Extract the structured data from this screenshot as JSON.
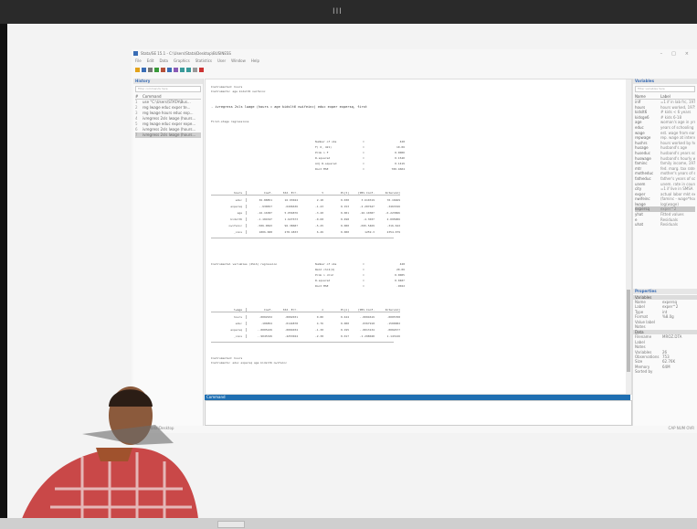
{
  "window": {
    "title": "Stata/SE 15.1 - C:\\Users\\Stata\\Desktop\\BUSINESS",
    "controls": [
      "–",
      "□",
      "×"
    ]
  },
  "menu": [
    "File",
    "Edit",
    "Data",
    "Graphics",
    "Statistics",
    "User",
    "Window",
    "Help"
  ],
  "toolbar_icons": [
    "open-icon",
    "save-icon",
    "print-icon",
    "log-icon",
    "viewer-icon",
    "graph-icon",
    "do-file-icon",
    "data-editor-icon",
    "data-browser-icon",
    "variables-manager-icon",
    "break-icon"
  ],
  "history": {
    "title": "History",
    "filter_placeholder": "Filter commands here",
    "columns": [
      "#",
      "Command"
    ],
    "items": [
      {
        "n": "1",
        "cmd": "use \"C:\\Users\\STATA\\Bus...",
        "selected": false
      },
      {
        "n": "2",
        "cmd": "reg lwage educ exper te...",
        "selected": false
      },
      {
        "n": "3",
        "cmd": "reg lwage hours educ exp...",
        "selected": false
      },
      {
        "n": "4",
        "cmd": "ivregress 2sls lwage (hours...",
        "selected": false
      },
      {
        "n": "5",
        "cmd": "reg lwage educ exper expe...",
        "selected": false
      },
      {
        "n": "6",
        "cmd": "ivregress 2sls lwage (hours...",
        "selected": false
      },
      {
        "n": "7",
        "cmd": "ivregress 2sls lwage (hours...",
        "selected": true
      }
    ]
  },
  "results": {
    "header_lines": [
      "Instrumented:  hours",
      "Instruments:   age kidslt6 nwifeinc"
    ],
    "command_line": ". ivregress 2sls lwage (hours = age kidslt6 nwifeinc) educ exper expersq, first",
    "first_stage_title": "First-stage regressions",
    "first_stage_stats": [
      {
        "k": "Number of obs",
        "v": "428"
      },
      {
        "k": "F(   6,    421)",
        "v": "10.06"
      },
      {
        "k": "Prob > F",
        "v": "0.0000"
      },
      {
        "k": "R-squared",
        "v": "0.1540"
      },
      {
        "k": "Adj R-squared",
        "v": "0.1419"
      },
      {
        "k": "Root MSE",
        "v": "700.4604"
      }
    ],
    "coef_columns": [
      "hours",
      "Coef.",
      "Std. Err.",
      "t",
      "P>|t|",
      "[95% Conf.",
      "Interval]"
    ],
    "first_stage_rows": [
      [
        "educ",
        "36.88851",
        "16.93044",
        "2.18",
        "0.030",
        "3.610319",
        "70.16669"
      ],
      [
        "expersq",
        "-.930657",
        ".6496636",
        "-1.43",
        "0.153",
        "-2.207647",
        ".3463326"
      ],
      [
        "age",
        "-16.16387",
        "5.056876",
        "-3.20",
        "0.001",
        "-26.10387",
        "-6.223866"
      ],
      [
        "kidslt6",
        "-1.104347",
        "1.627673",
        "-0.68",
        "0.498",
        "-4.3037",
        "2.095006"
      ],
      [
        "nwifeinc",
        "-506.0843",
        "96.38687",
        "-5.25",
        "0.000",
        "-695.5469",
        "-316.622"
      ],
      [
        "_cons",
        "1806.688",
        "278.4833",
        "6.49",
        "0.000",
        "1259.3",
        "2354.079"
      ]
    ],
    "iv_title": "Instrumental variables (2SLS) regression",
    "iv_stats": [
      {
        "k": "Number of obs",
        "v": "428"
      },
      {
        "k": "Wald chi2(4)",
        "v": "20.06"
      },
      {
        "k": "Prob > chi2",
        "v": "0.0005"
      },
      {
        "k": "R-squared",
        "v": "0.0487"
      },
      {
        "k": "Root MSE",
        "v": ".9022"
      }
    ],
    "iv_columns": [
      "lwage",
      "Coef.",
      "Std. Err.",
      "z",
      "P>|z|",
      "[95% Conf.",
      "Interval]"
    ],
    "iv_rows": [
      [
        "hours",
        ".0002932",
        ".0002031",
        "0.80",
        "0.424",
        "-.0004619",
        ".0005708"
      ],
      [
        "educ",
        ".106854",
        ".0144878",
        "4.76",
        "0.000",
        ".0367918",
        ".1500082"
      ],
      [
        "expersq",
        "-.0005229",
        ".0004034",
        "-1.30",
        "0.195",
        "-.0013134",
        ".0002677"
      ],
      [
        "_cons",
        "-.9045349",
        ".4253024",
        "-2.38",
        "0.017",
        "-1.298048",
        "1.143126"
      ]
    ],
    "footer_lines": [
      "Instrumented:  hours",
      "Instruments:   educ expersq age kidslt6 nwifeinc"
    ]
  },
  "command": {
    "title": "Command",
    "value": ""
  },
  "variables": {
    "title": "Variables",
    "filter_placeholder": "Filter variables here",
    "columns": [
      "Name",
      "Label"
    ],
    "items": [
      {
        "name": "inlf",
        "label": "=1 if in lab frc, 1975",
        "selected": false
      },
      {
        "name": "hours",
        "label": "hours worked, 1975",
        "selected": false
      },
      {
        "name": "kidslt6",
        "label": "# kids < 6 years",
        "selected": false
      },
      {
        "name": "kidsge6",
        "label": "# kids 6-18",
        "selected": false
      },
      {
        "name": "age",
        "label": "woman's age in yrs",
        "selected": false
      },
      {
        "name": "educ",
        "label": "years of schooling",
        "selected": false
      },
      {
        "name": "wage",
        "label": "est. wage from earn",
        "selected": false
      },
      {
        "name": "repwage",
        "label": "rep. wage at interview",
        "selected": false
      },
      {
        "name": "hushrs",
        "label": "hours worked by hus",
        "selected": false
      },
      {
        "name": "husage",
        "label": "husband's age",
        "selected": false
      },
      {
        "name": "huseduc",
        "label": "husband's years sch",
        "selected": false
      },
      {
        "name": "huswage",
        "label": "husband's hourly wage",
        "selected": false
      },
      {
        "name": "faminc",
        "label": "family income, 1975",
        "selected": false
      },
      {
        "name": "mtr",
        "label": "fed. marg. tax rate",
        "selected": false
      },
      {
        "name": "motheduc",
        "label": "mother's years of sch",
        "selected": false
      },
      {
        "name": "fatheduc",
        "label": "father's years of sch",
        "selected": false
      },
      {
        "name": "unem",
        "label": "unem. rate in county",
        "selected": false
      },
      {
        "name": "city",
        "label": "=1 if live in SMSA",
        "selected": false
      },
      {
        "name": "exper",
        "label": "actual labor mkt exper",
        "selected": false
      },
      {
        "name": "nwifeinc",
        "label": "(faminc - wage*hours)",
        "selected": false
      },
      {
        "name": "lwage",
        "label": "log(wage)",
        "selected": false
      },
      {
        "name": "expersq",
        "label": "exper^2",
        "selected": true
      },
      {
        "name": "yhat",
        "label": "Fitted values",
        "selected": false
      },
      {
        "name": "e",
        "label": "Residuals",
        "selected": false
      },
      {
        "name": "uhat",
        "label": "Residuals",
        "selected": false
      }
    ]
  },
  "properties": {
    "title": "Properties",
    "var_section": "Variables",
    "var_rows": [
      {
        "k": "Name",
        "v": "expersq"
      },
      {
        "k": "Label",
        "v": "exper^2"
      },
      {
        "k": "Type",
        "v": "int"
      },
      {
        "k": "Format",
        "v": "%8.0g"
      },
      {
        "k": "Value label",
        "v": ""
      },
      {
        "k": "Notes",
        "v": ""
      }
    ],
    "data_section": "Data",
    "data_rows": [
      {
        "k": "Filename",
        "v": "MROZ.DTA"
      },
      {
        "k": "Label",
        "v": ""
      },
      {
        "k": "Notes",
        "v": ""
      },
      {
        "k": "Variables",
        "v": "26"
      },
      {
        "k": "Observations",
        "v": "753"
      },
      {
        "k": "Size",
        "v": "62.76K"
      },
      {
        "k": "Memory",
        "v": "64M"
      },
      {
        "k": "Sorted by",
        "v": ""
      }
    ]
  },
  "statusbar": {
    "path": "C:\\Users\\Stata\\Desktop",
    "right": "CAP  NUM  OVR"
  },
  "taskbar_grip": "III"
}
